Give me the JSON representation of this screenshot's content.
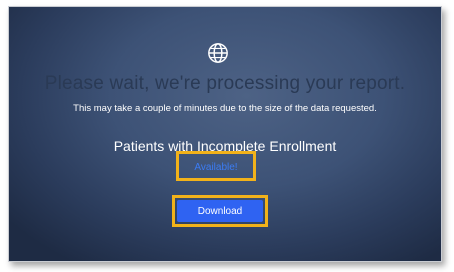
{
  "icons": {
    "globe": "globe-icon"
  },
  "main": {
    "title": "Please wait, we're processing your report.",
    "subtitle": "This may take a couple of minutes due to the size of the data requested.",
    "report_name": "Patients with Incomplete Enrollment",
    "status": "Available!",
    "download_label": "Download"
  },
  "colors": {
    "highlight": "#f2b21a",
    "button": "#2f63f2",
    "status_text": "#3b7cf4"
  }
}
